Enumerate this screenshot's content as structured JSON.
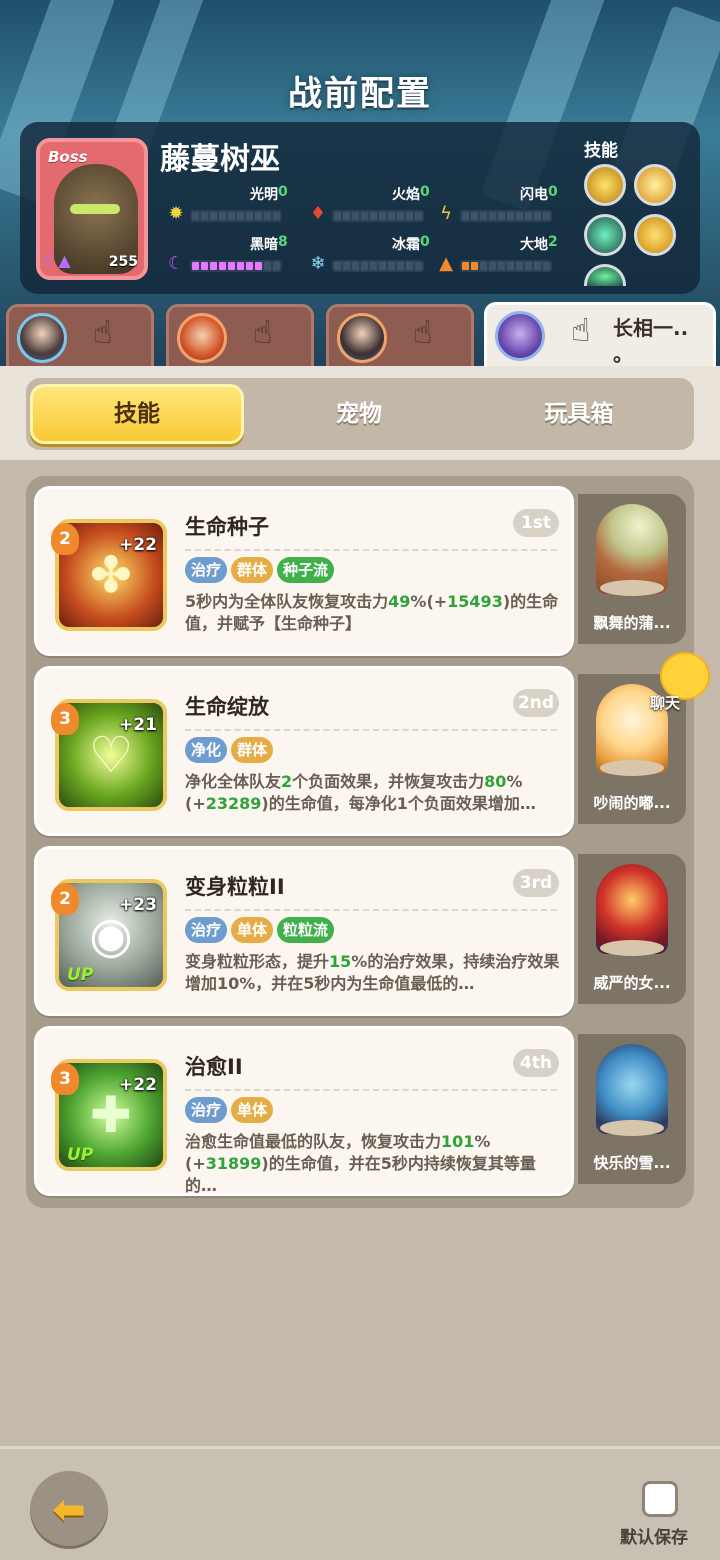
{
  "page_title": "战前配置",
  "boss": {
    "tag": "Boss",
    "name": "藤蔓树巫",
    "level": "255",
    "elements": [
      {
        "label": "光明",
        "value": "0",
        "icon": "sun-icon",
        "filled": 0,
        "color": "#f3d23e"
      },
      {
        "label": "火焰",
        "value": "0",
        "icon": "flame-icon",
        "filled": 0,
        "color": "#e44a2c"
      },
      {
        "label": "闪电",
        "value": "0",
        "icon": "lightning-icon",
        "filled": 0,
        "color": "#f2c534"
      },
      {
        "label": "黑暗",
        "value": "8",
        "icon": "moon-icon",
        "filled": 8,
        "color": "#c257f0"
      },
      {
        "label": "冰霜",
        "value": "0",
        "icon": "snowflake-icon",
        "filled": 0,
        "color": "#8dd3f5"
      },
      {
        "label": "大地",
        "value": "2",
        "icon": "mountain-icon",
        "filled": 2,
        "color": "#f08a2d"
      }
    ],
    "skills_label": "技能"
  },
  "heroes": [
    {
      "name": ""
    },
    {
      "name": ""
    },
    {
      "name": ""
    },
    {
      "name": "长相一..\n。"
    }
  ],
  "tabs": [
    {
      "label": "技能",
      "active": true
    },
    {
      "label": "宠物",
      "active": false
    },
    {
      "label": "玩具箱",
      "active": false
    }
  ],
  "skills": [
    {
      "name": "生命种子",
      "rank": "1st",
      "level": "2",
      "plus": "+22",
      "up": "",
      "tags": [
        {
          "text": "治疗",
          "color": "blue"
        },
        {
          "text": "群体",
          "color": "orange"
        },
        {
          "text": "种子流",
          "color": "green"
        }
      ],
      "desc_parts": [
        "5秒内为全体队友恢复攻击力",
        "49",
        "%(+",
        "15493",
        ")的生命值，并赋予【生命种子】"
      ]
    },
    {
      "name": "生命绽放",
      "rank": "2nd",
      "level": "3",
      "plus": "+21",
      "up": "",
      "tags": [
        {
          "text": "净化",
          "color": "blue"
        },
        {
          "text": "群体",
          "color": "orange"
        }
      ],
      "desc_parts": [
        "净化全体队友",
        "2",
        "个负面效果，并恢复攻击力",
        "80",
        "%(+",
        "23289",
        ")的生命值，每净化1个负面效果增加…"
      ]
    },
    {
      "name": "变身粒粒II",
      "rank": "3rd",
      "level": "2",
      "plus": "+23",
      "up": "UP",
      "tags": [
        {
          "text": "治疗",
          "color": "blue"
        },
        {
          "text": "单体",
          "color": "orange"
        },
        {
          "text": "粒粒流",
          "color": "green"
        }
      ],
      "desc_parts": [
        "变身粒粒形态，提升",
        "15",
        "%的治疗效果，持续治疗效果增加10%，并在5秒内为生命值最低的…"
      ]
    },
    {
      "name": "治愈II",
      "rank": "4th",
      "level": "3",
      "plus": "+22",
      "up": "UP",
      "tags": [
        {
          "text": "治疗",
          "color": "blue"
        },
        {
          "text": "单体",
          "color": "orange"
        }
      ],
      "desc_parts": [
        "治愈生命值最低的队友，恢复攻击力",
        "101",
        "%(+",
        "31899",
        ")的生命值，并在5秒内持续恢复其等量的…"
      ]
    }
  ],
  "pets": [
    {
      "name": "飘舞的蒲..."
    },
    {
      "name": "吵闹的嘟..."
    },
    {
      "name": "威严的女..."
    },
    {
      "name": "快乐的雪..."
    }
  ],
  "chat_label": "聊天",
  "footer": {
    "default_save": "默认保存"
  }
}
